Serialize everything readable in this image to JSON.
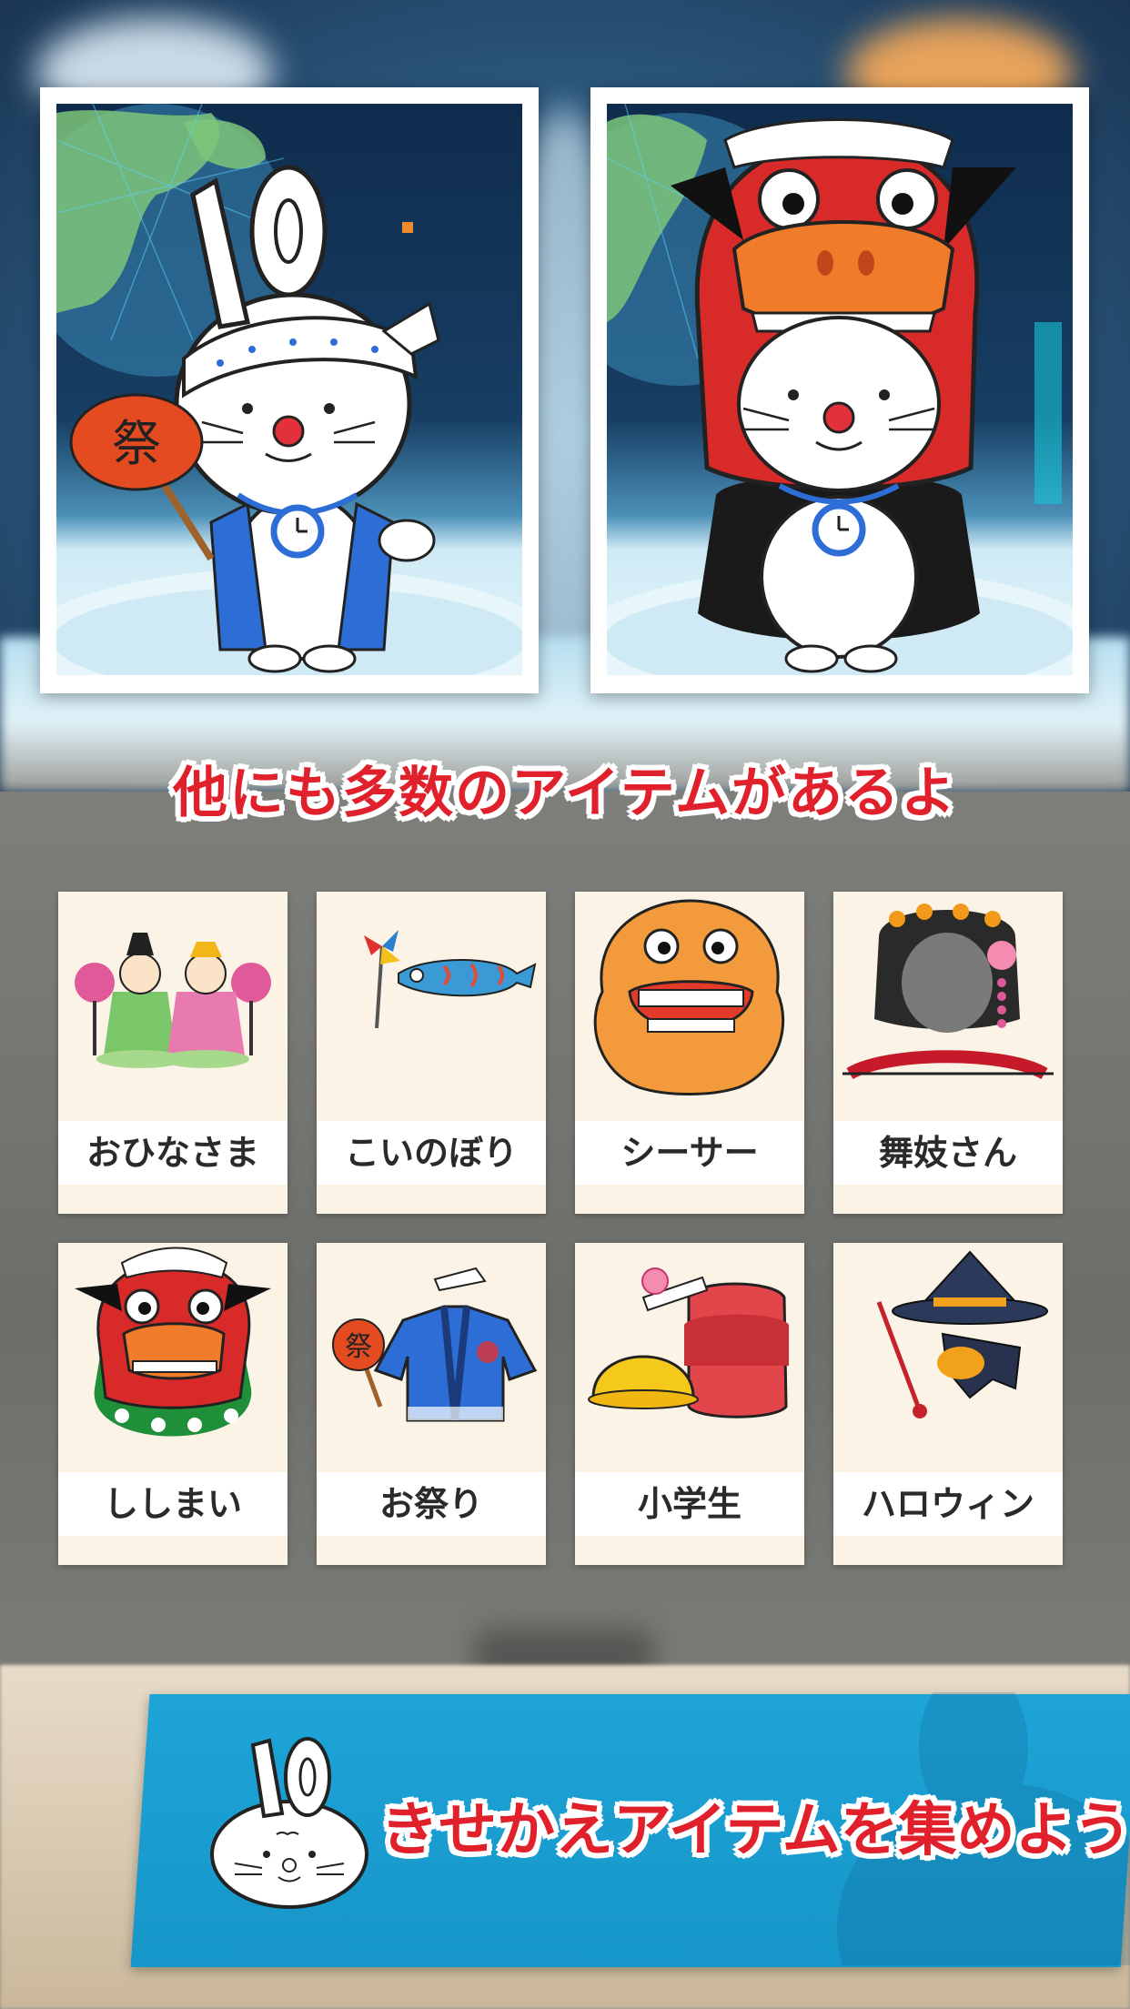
{
  "screenshots": [
    {
      "id": "festival",
      "fan_text": "祭",
      "ears_number": "10"
    },
    {
      "id": "shishimai"
    }
  ],
  "headline": "他にも多数のアイテムがあるよ",
  "items": [
    {
      "label": "おひなさま",
      "icon": "hina-dolls-icon"
    },
    {
      "label": "こいのぼり",
      "icon": "koinobori-icon"
    },
    {
      "label": "シーサー",
      "icon": "shisa-icon"
    },
    {
      "label": "舞妓さん",
      "icon": "maiko-icon"
    },
    {
      "label": "ししまい",
      "icon": "shishimai-icon"
    },
    {
      "label": "お祭り",
      "icon": "festival-happi-icon",
      "fan_text": "祭"
    },
    {
      "label": "小学生",
      "icon": "schoolkid-icon"
    },
    {
      "label": "ハロウィン",
      "icon": "halloween-witch-icon"
    }
  ],
  "banner": {
    "text": "きせかえアイテムを集めよう!",
    "avatar_number": "10"
  },
  "colors": {
    "headline": "#e0202a",
    "banner_bg": "#1ea4d7",
    "card_bg": "#faf3e6"
  }
}
